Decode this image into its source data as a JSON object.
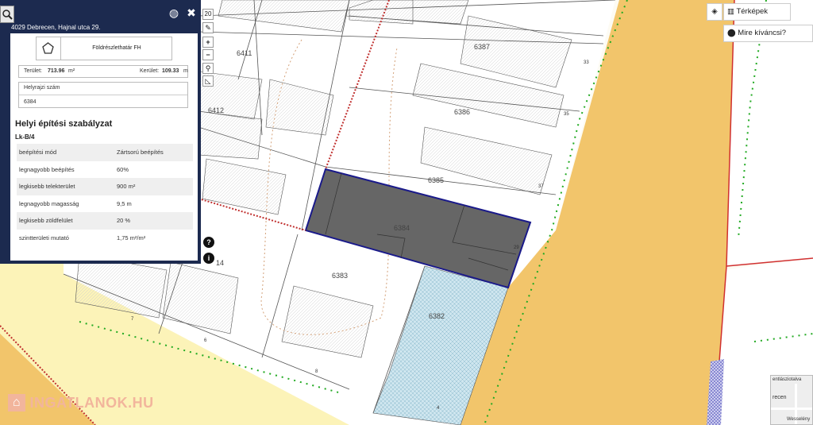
{
  "panel": {
    "address": "4029 Debrecen, Hajnal utca 29.",
    "category": "Földrészlethatár FH",
    "area_label": "Terület:",
    "area_value": "713.96",
    "area_unit": "m²",
    "perimeter_label": "Kerület:",
    "perimeter_value": "109.33",
    "perimeter_unit": "m",
    "hrsz_label": "Helyrajzi szám",
    "hrsz_value": "6384",
    "section_title": "Helyi építési szabályzat",
    "zone_code": "Lk-B/4",
    "rules": [
      {
        "name": "beépítési mód",
        "value": "Zártsorú beépítés"
      },
      {
        "name": "legnagyobb beépítés",
        "value": "60%"
      },
      {
        "name": "legkisebb telekterület",
        "value": "900 m²"
      },
      {
        "name": "legnagyobb magasság",
        "value": "9,5 m"
      },
      {
        "name": "legkisebb zöldfelület",
        "value": "20 %"
      },
      {
        "name": "szintterületi mutató",
        "value": "1,75 m²/m²"
      }
    ]
  },
  "toolbar": {
    "zoom_level": "20",
    "zoom_in": "+",
    "zoom_out": "−",
    "help": "?",
    "info": "i"
  },
  "map_controls": {
    "maps_label": "Térképek",
    "search_label": "Mire kíváncsi?"
  },
  "parcels": [
    "6411",
    "6387",
    "6412",
    "6386",
    "6385",
    "6384",
    "6383",
    "6382",
    "14"
  ],
  "house_numbers": [
    "33",
    "35",
    "37",
    "29",
    "7",
    "6",
    "8",
    "4"
  ],
  "minimap": {
    "line1": "entlásziotalva",
    "line2": "recen",
    "line3": "Wesselény"
  },
  "logo": {
    "text": "INGATLANOK.HU"
  },
  "colors": {
    "panel": "#1c2a4f",
    "selected_parcel": "#666666",
    "selected_border": "#1a1a8a",
    "road": "#f2c56b",
    "zone_yellow": "#fcf3b8"
  }
}
